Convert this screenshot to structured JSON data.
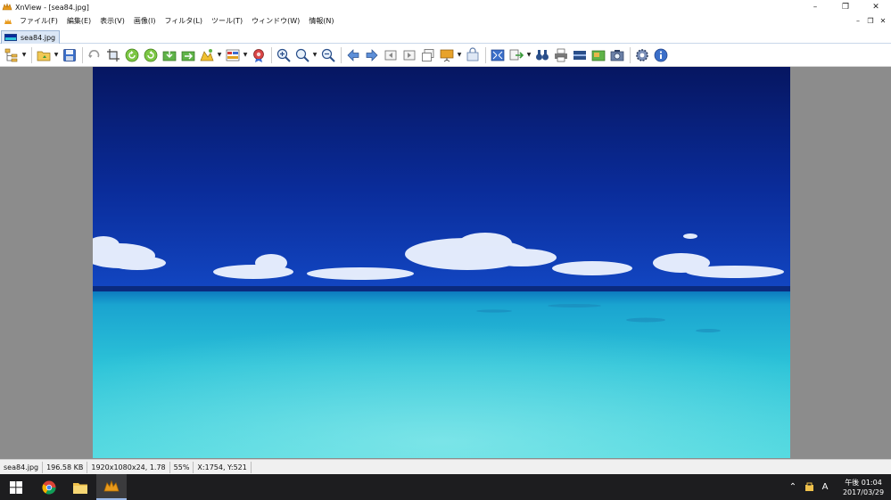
{
  "window": {
    "title": "XnView - [sea84.jpg]",
    "controls": [
      "minimize-icon",
      "restore-icon",
      "close-icon"
    ]
  },
  "menu": {
    "items": [
      "ファイル(F)",
      "編集(E)",
      "表示(V)",
      "画像(I)",
      "フィルタ(L)",
      "ツール(T)",
      "ウィンドウ(W)",
      "情報(N)"
    ]
  },
  "tabs": [
    {
      "label": "sea84.jpg",
      "active": true
    }
  ],
  "toolbar": {
    "icons": [
      "browser-tree-icon",
      "open-folder-icon",
      "save-icon",
      "undo-icon",
      "crop-icon",
      "rotate-left-icon",
      "rotate-right-icon",
      "import-icon",
      "export-icon",
      "adjust-icon",
      "color-icon",
      "effects-icon",
      "zoom-in-icon",
      "zoom-icon",
      "zoom-out-icon",
      "previous-icon",
      "next-icon",
      "first-icon",
      "last-icon",
      "slideshow-icon",
      "copy-icon",
      "fullscreen-icon",
      "convert-icon",
      "find-icon",
      "print-icon",
      "scanner-icon",
      "capture-icon",
      "camera-icon",
      "settings-icon",
      "info-icon"
    ]
  },
  "status": {
    "filename": "sea84.jpg",
    "filesize": "196.58 KB",
    "dimensions": "1920x1080x24, 1.78",
    "zoom": "55%",
    "cursor": "X:1754, Y:521"
  },
  "taskbar": {
    "apps": [
      "chrome-icon",
      "file-explorer-icon",
      "xnview-icon"
    ],
    "clock_time": "午後 01:04",
    "clock_date": "2017/03/29",
    "ime": "A"
  },
  "colors": {
    "sky_top": "#071a6e",
    "sky_bottom": "#0f3fc0",
    "sea_near": "#3ed2dc",
    "sea_far": "#1599c8",
    "viewer_bg": "#8c8c8c",
    "taskbar_bg": "#1d1d1f"
  }
}
